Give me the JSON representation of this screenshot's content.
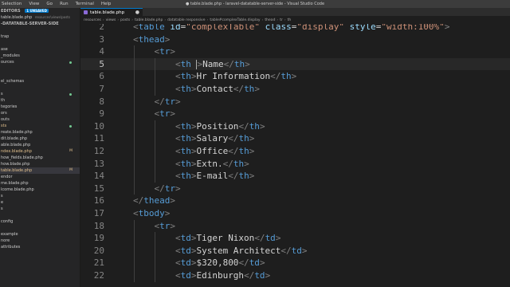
{
  "menu": [
    "Selection",
    "View",
    "Go",
    "Run",
    "Terminal",
    "Help"
  ],
  "window_title": "● table.blade.php - laravel-datatable-server-side - Visual Studio Code",
  "sidebar": {
    "open_editors_label": "EDITORS",
    "unsaved_badge": "1 UNSAVED",
    "open_file": "table.blade.php",
    "open_file_path": "resources\\views\\posts",
    "project_label": "-DATATABLE-SERVER-SIDE",
    "items": [
      {
        "label": "",
        "status": "",
        "mod": false
      },
      {
        "label": "trap",
        "status": "",
        "mod": false
      },
      {
        "label": "",
        "status": "",
        "mod": false
      },
      {
        "label": "ase",
        "status": "",
        "mod": false
      },
      {
        "label": "_modules",
        "status": "",
        "mod": false
      },
      {
        "label": "ources",
        "status": "dot",
        "mod": false
      },
      {
        "label": "",
        "status": "",
        "mod": false
      },
      {
        "label": "",
        "status": "",
        "mod": false
      },
      {
        "label": "el_schemas",
        "status": "",
        "mod": false
      },
      {
        "label": "",
        "status": "",
        "mod": false
      },
      {
        "label": "s",
        "status": "dot",
        "mod": false
      },
      {
        "label": "th",
        "status": "",
        "mod": false
      },
      {
        "label": "tegories",
        "status": "",
        "mod": false
      },
      {
        "label": "ors",
        "status": "",
        "mod": false
      },
      {
        "label": "outs",
        "status": "",
        "mod": false
      },
      {
        "label": "sts",
        "status": "dot",
        "mod": true
      },
      {
        "label": "reate.blade.php",
        "status": "",
        "mod": false
      },
      {
        "label": "dit.blade.php",
        "status": "",
        "mod": false
      },
      {
        "label": "able.blade.php",
        "status": "",
        "mod": false
      },
      {
        "label": "ndex.blade.php",
        "status": "M",
        "mod": true
      },
      {
        "label": "how_fields.blade.php",
        "status": "",
        "mod": false
      },
      {
        "label": "how.blade.php",
        "status": "",
        "mod": false
      },
      {
        "label": "table.blade.php",
        "status": "M",
        "mod": true,
        "selected": true
      },
      {
        "label": "endor",
        "status": "",
        "mod": false
      },
      {
        "label": "me.blade.php",
        "status": "",
        "mod": false
      },
      {
        "label": "lcome.blade.php",
        "status": "",
        "mod": false
      },
      {
        "label": "s",
        "status": "",
        "mod": false
      },
      {
        "label": "e",
        "status": "",
        "mod": false
      },
      {
        "label": "s",
        "status": "",
        "mod": false
      },
      {
        "label": "",
        "status": "",
        "mod": false
      },
      {
        "label": "config",
        "status": "",
        "mod": false
      },
      {
        "label": "",
        "status": "",
        "mod": false
      },
      {
        "label": "example",
        "status": "",
        "mod": false
      },
      {
        "label": "nore",
        "status": "",
        "mod": false
      },
      {
        "label": "attributes",
        "status": "",
        "mod": false
      }
    ]
  },
  "tab": {
    "label": "table.blade.php",
    "close": "●"
  },
  "breadcrumb": [
    "resources",
    "views",
    "posts",
    "table.blade.php",
    "datatable responsive",
    "table#complexTable.display",
    "thead",
    "tr",
    "th"
  ],
  "editor": {
    "active_line": 5,
    "lines": [
      {
        "n": "2",
        "indent": 0,
        "tokens": [
          [
            "p",
            "<"
          ],
          [
            "t",
            "table"
          ],
          [
            "txt",
            " "
          ],
          [
            "a",
            "id"
          ],
          [
            "txt",
            "="
          ],
          [
            "s",
            "\"complexTable\""
          ],
          [
            "txt",
            " "
          ],
          [
            "a",
            "class"
          ],
          [
            "txt",
            "="
          ],
          [
            "s",
            "\"display\""
          ],
          [
            "txt",
            " "
          ],
          [
            "a",
            "style"
          ],
          [
            "txt",
            "="
          ],
          [
            "s",
            "\"width:100%\""
          ],
          [
            "p",
            ">"
          ]
        ]
      },
      {
        "n": "3",
        "indent": 0,
        "tokens": [
          [
            "p",
            "<"
          ],
          [
            "t",
            "thead"
          ],
          [
            "p",
            ">"
          ]
        ]
      },
      {
        "n": "4",
        "indent": 1,
        "tokens": [
          [
            "p",
            "<"
          ],
          [
            "t",
            "tr"
          ],
          [
            "p",
            ">"
          ]
        ]
      },
      {
        "n": "5",
        "indent": 2,
        "tokens": [
          [
            "p",
            "<"
          ],
          [
            "t",
            "th"
          ],
          [
            "txt",
            " "
          ],
          [
            "cursor",
            ""
          ],
          [
            "p",
            ">"
          ],
          [
            "txt",
            "Name"
          ],
          [
            "p",
            "</"
          ],
          [
            "t",
            "th"
          ],
          [
            "p",
            ">"
          ]
        ]
      },
      {
        "n": "6",
        "indent": 2,
        "tokens": [
          [
            "p",
            "<"
          ],
          [
            "t",
            "th"
          ],
          [
            "p",
            ">"
          ],
          [
            "txt",
            "Hr Information"
          ],
          [
            "p",
            "</"
          ],
          [
            "t",
            "th"
          ],
          [
            "p",
            ">"
          ]
        ]
      },
      {
        "n": "7",
        "indent": 2,
        "tokens": [
          [
            "p",
            "<"
          ],
          [
            "t",
            "th"
          ],
          [
            "p",
            ">"
          ],
          [
            "txt",
            "Contact"
          ],
          [
            "p",
            "</"
          ],
          [
            "t",
            "th"
          ],
          [
            "p",
            ">"
          ]
        ]
      },
      {
        "n": "8",
        "indent": 1,
        "tokens": [
          [
            "p",
            "</"
          ],
          [
            "t",
            "tr"
          ],
          [
            "p",
            ">"
          ]
        ]
      },
      {
        "n": "9",
        "indent": 1,
        "tokens": [
          [
            "p",
            "<"
          ],
          [
            "t",
            "tr"
          ],
          [
            "p",
            ">"
          ]
        ]
      },
      {
        "n": "10",
        "indent": 2,
        "tokens": [
          [
            "p",
            "<"
          ],
          [
            "t",
            "th"
          ],
          [
            "p",
            ">"
          ],
          [
            "txt",
            "Position"
          ],
          [
            "p",
            "</"
          ],
          [
            "t",
            "th"
          ],
          [
            "p",
            ">"
          ]
        ]
      },
      {
        "n": "11",
        "indent": 2,
        "tokens": [
          [
            "p",
            "<"
          ],
          [
            "t",
            "th"
          ],
          [
            "p",
            ">"
          ],
          [
            "txt",
            "Salary"
          ],
          [
            "p",
            "</"
          ],
          [
            "t",
            "th"
          ],
          [
            "p",
            ">"
          ]
        ]
      },
      {
        "n": "12",
        "indent": 2,
        "tokens": [
          [
            "p",
            "<"
          ],
          [
            "t",
            "th"
          ],
          [
            "p",
            ">"
          ],
          [
            "txt",
            "Office"
          ],
          [
            "p",
            "</"
          ],
          [
            "t",
            "th"
          ],
          [
            "p",
            ">"
          ]
        ]
      },
      {
        "n": "13",
        "indent": 2,
        "tokens": [
          [
            "p",
            "<"
          ],
          [
            "t",
            "th"
          ],
          [
            "p",
            ">"
          ],
          [
            "txt",
            "Extn."
          ],
          [
            "p",
            "</"
          ],
          [
            "t",
            "th"
          ],
          [
            "p",
            ">"
          ]
        ]
      },
      {
        "n": "14",
        "indent": 2,
        "tokens": [
          [
            "p",
            "<"
          ],
          [
            "t",
            "th"
          ],
          [
            "p",
            ">"
          ],
          [
            "txt",
            "E-mail"
          ],
          [
            "p",
            "</"
          ],
          [
            "t",
            "th"
          ],
          [
            "p",
            ">"
          ]
        ]
      },
      {
        "n": "15",
        "indent": 1,
        "tokens": [
          [
            "p",
            "</"
          ],
          [
            "t",
            "tr"
          ],
          [
            "p",
            ">"
          ]
        ]
      },
      {
        "n": "16",
        "indent": 0,
        "tokens": [
          [
            "p",
            "</"
          ],
          [
            "t",
            "thead"
          ],
          [
            "p",
            ">"
          ]
        ]
      },
      {
        "n": "17",
        "indent": 0,
        "tokens": [
          [
            "p",
            "<"
          ],
          [
            "t",
            "tbody"
          ],
          [
            "p",
            ">"
          ]
        ]
      },
      {
        "n": "18",
        "indent": 1,
        "tokens": [
          [
            "p",
            "<"
          ],
          [
            "t",
            "tr"
          ],
          [
            "p",
            ">"
          ]
        ]
      },
      {
        "n": "19",
        "indent": 2,
        "tokens": [
          [
            "p",
            "<"
          ],
          [
            "t",
            "td"
          ],
          [
            "p",
            ">"
          ],
          [
            "txt",
            "Tiger Nixon"
          ],
          [
            "p",
            "</"
          ],
          [
            "t",
            "td"
          ],
          [
            "p",
            ">"
          ]
        ]
      },
      {
        "n": "20",
        "indent": 2,
        "tokens": [
          [
            "p",
            "<"
          ],
          [
            "t",
            "td"
          ],
          [
            "p",
            ">"
          ],
          [
            "txt",
            "System Architect"
          ],
          [
            "p",
            "</"
          ],
          [
            "t",
            "td"
          ],
          [
            "p",
            ">"
          ]
        ]
      },
      {
        "n": "21",
        "indent": 2,
        "tokens": [
          [
            "p",
            "<"
          ],
          [
            "t",
            "td"
          ],
          [
            "p",
            ">"
          ],
          [
            "txt",
            "$320,800"
          ],
          [
            "p",
            "</"
          ],
          [
            "t",
            "td"
          ],
          [
            "p",
            ">"
          ]
        ]
      },
      {
        "n": "22",
        "indent": 2,
        "tokens": [
          [
            "p",
            "<"
          ],
          [
            "t",
            "td"
          ],
          [
            "p",
            ">"
          ],
          [
            "txt",
            "Edinburgh"
          ],
          [
            "p",
            "</"
          ],
          [
            "t",
            "td"
          ],
          [
            "p",
            ">"
          ]
        ]
      }
    ]
  }
}
